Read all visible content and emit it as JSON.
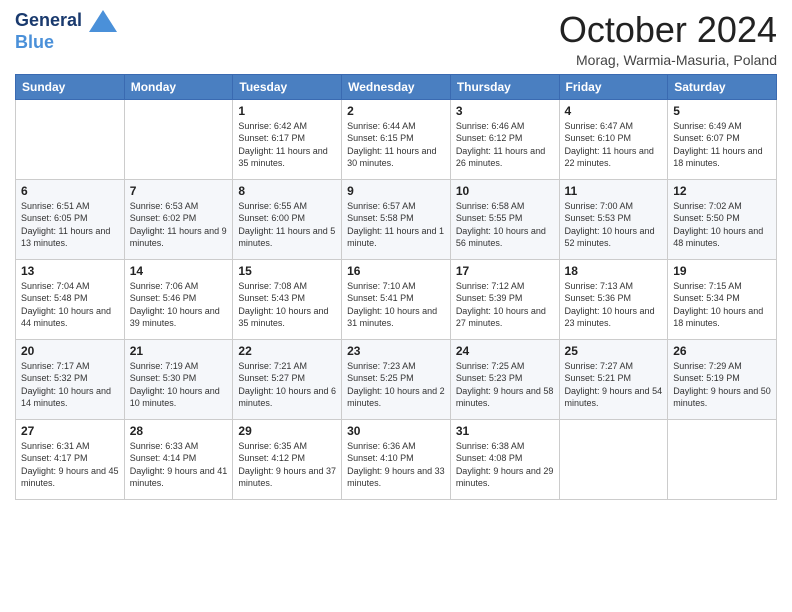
{
  "header": {
    "logo_line1": "General",
    "logo_line2": "Blue",
    "month_title": "October 2024",
    "location": "Morag, Warmia-Masuria, Poland"
  },
  "days_of_week": [
    "Sunday",
    "Monday",
    "Tuesday",
    "Wednesday",
    "Thursday",
    "Friday",
    "Saturday"
  ],
  "weeks": [
    [
      {
        "day": "",
        "sunrise": "",
        "sunset": "",
        "daylight": ""
      },
      {
        "day": "",
        "sunrise": "",
        "sunset": "",
        "daylight": ""
      },
      {
        "day": "1",
        "sunrise": "Sunrise: 6:42 AM",
        "sunset": "Sunset: 6:17 PM",
        "daylight": "Daylight: 11 hours and 35 minutes."
      },
      {
        "day": "2",
        "sunrise": "Sunrise: 6:44 AM",
        "sunset": "Sunset: 6:15 PM",
        "daylight": "Daylight: 11 hours and 30 minutes."
      },
      {
        "day": "3",
        "sunrise": "Sunrise: 6:46 AM",
        "sunset": "Sunset: 6:12 PM",
        "daylight": "Daylight: 11 hours and 26 minutes."
      },
      {
        "day": "4",
        "sunrise": "Sunrise: 6:47 AM",
        "sunset": "Sunset: 6:10 PM",
        "daylight": "Daylight: 11 hours and 22 minutes."
      },
      {
        "day": "5",
        "sunrise": "Sunrise: 6:49 AM",
        "sunset": "Sunset: 6:07 PM",
        "daylight": "Daylight: 11 hours and 18 minutes."
      }
    ],
    [
      {
        "day": "6",
        "sunrise": "Sunrise: 6:51 AM",
        "sunset": "Sunset: 6:05 PM",
        "daylight": "Daylight: 11 hours and 13 minutes."
      },
      {
        "day": "7",
        "sunrise": "Sunrise: 6:53 AM",
        "sunset": "Sunset: 6:02 PM",
        "daylight": "Daylight: 11 hours and 9 minutes."
      },
      {
        "day": "8",
        "sunrise": "Sunrise: 6:55 AM",
        "sunset": "Sunset: 6:00 PM",
        "daylight": "Daylight: 11 hours and 5 minutes."
      },
      {
        "day": "9",
        "sunrise": "Sunrise: 6:57 AM",
        "sunset": "Sunset: 5:58 PM",
        "daylight": "Daylight: 11 hours and 1 minute."
      },
      {
        "day": "10",
        "sunrise": "Sunrise: 6:58 AM",
        "sunset": "Sunset: 5:55 PM",
        "daylight": "Daylight: 10 hours and 56 minutes."
      },
      {
        "day": "11",
        "sunrise": "Sunrise: 7:00 AM",
        "sunset": "Sunset: 5:53 PM",
        "daylight": "Daylight: 10 hours and 52 minutes."
      },
      {
        "day": "12",
        "sunrise": "Sunrise: 7:02 AM",
        "sunset": "Sunset: 5:50 PM",
        "daylight": "Daylight: 10 hours and 48 minutes."
      }
    ],
    [
      {
        "day": "13",
        "sunrise": "Sunrise: 7:04 AM",
        "sunset": "Sunset: 5:48 PM",
        "daylight": "Daylight: 10 hours and 44 minutes."
      },
      {
        "day": "14",
        "sunrise": "Sunrise: 7:06 AM",
        "sunset": "Sunset: 5:46 PM",
        "daylight": "Daylight: 10 hours and 39 minutes."
      },
      {
        "day": "15",
        "sunrise": "Sunrise: 7:08 AM",
        "sunset": "Sunset: 5:43 PM",
        "daylight": "Daylight: 10 hours and 35 minutes."
      },
      {
        "day": "16",
        "sunrise": "Sunrise: 7:10 AM",
        "sunset": "Sunset: 5:41 PM",
        "daylight": "Daylight: 10 hours and 31 minutes."
      },
      {
        "day": "17",
        "sunrise": "Sunrise: 7:12 AM",
        "sunset": "Sunset: 5:39 PM",
        "daylight": "Daylight: 10 hours and 27 minutes."
      },
      {
        "day": "18",
        "sunrise": "Sunrise: 7:13 AM",
        "sunset": "Sunset: 5:36 PM",
        "daylight": "Daylight: 10 hours and 23 minutes."
      },
      {
        "day": "19",
        "sunrise": "Sunrise: 7:15 AM",
        "sunset": "Sunset: 5:34 PM",
        "daylight": "Daylight: 10 hours and 18 minutes."
      }
    ],
    [
      {
        "day": "20",
        "sunrise": "Sunrise: 7:17 AM",
        "sunset": "Sunset: 5:32 PM",
        "daylight": "Daylight: 10 hours and 14 minutes."
      },
      {
        "day": "21",
        "sunrise": "Sunrise: 7:19 AM",
        "sunset": "Sunset: 5:30 PM",
        "daylight": "Daylight: 10 hours and 10 minutes."
      },
      {
        "day": "22",
        "sunrise": "Sunrise: 7:21 AM",
        "sunset": "Sunset: 5:27 PM",
        "daylight": "Daylight: 10 hours and 6 minutes."
      },
      {
        "day": "23",
        "sunrise": "Sunrise: 7:23 AM",
        "sunset": "Sunset: 5:25 PM",
        "daylight": "Daylight: 10 hours and 2 minutes."
      },
      {
        "day": "24",
        "sunrise": "Sunrise: 7:25 AM",
        "sunset": "Sunset: 5:23 PM",
        "daylight": "Daylight: 9 hours and 58 minutes."
      },
      {
        "day": "25",
        "sunrise": "Sunrise: 7:27 AM",
        "sunset": "Sunset: 5:21 PM",
        "daylight": "Daylight: 9 hours and 54 minutes."
      },
      {
        "day": "26",
        "sunrise": "Sunrise: 7:29 AM",
        "sunset": "Sunset: 5:19 PM",
        "daylight": "Daylight: 9 hours and 50 minutes."
      }
    ],
    [
      {
        "day": "27",
        "sunrise": "Sunrise: 6:31 AM",
        "sunset": "Sunset: 4:17 PM",
        "daylight": "Daylight: 9 hours and 45 minutes."
      },
      {
        "day": "28",
        "sunrise": "Sunrise: 6:33 AM",
        "sunset": "Sunset: 4:14 PM",
        "daylight": "Daylight: 9 hours and 41 minutes."
      },
      {
        "day": "29",
        "sunrise": "Sunrise: 6:35 AM",
        "sunset": "Sunset: 4:12 PM",
        "daylight": "Daylight: 9 hours and 37 minutes."
      },
      {
        "day": "30",
        "sunrise": "Sunrise: 6:36 AM",
        "sunset": "Sunset: 4:10 PM",
        "daylight": "Daylight: 9 hours and 33 minutes."
      },
      {
        "day": "31",
        "sunrise": "Sunrise: 6:38 AM",
        "sunset": "Sunset: 4:08 PM",
        "daylight": "Daylight: 9 hours and 29 minutes."
      },
      {
        "day": "",
        "sunrise": "",
        "sunset": "",
        "daylight": ""
      },
      {
        "day": "",
        "sunrise": "",
        "sunset": "",
        "daylight": ""
      }
    ]
  ]
}
